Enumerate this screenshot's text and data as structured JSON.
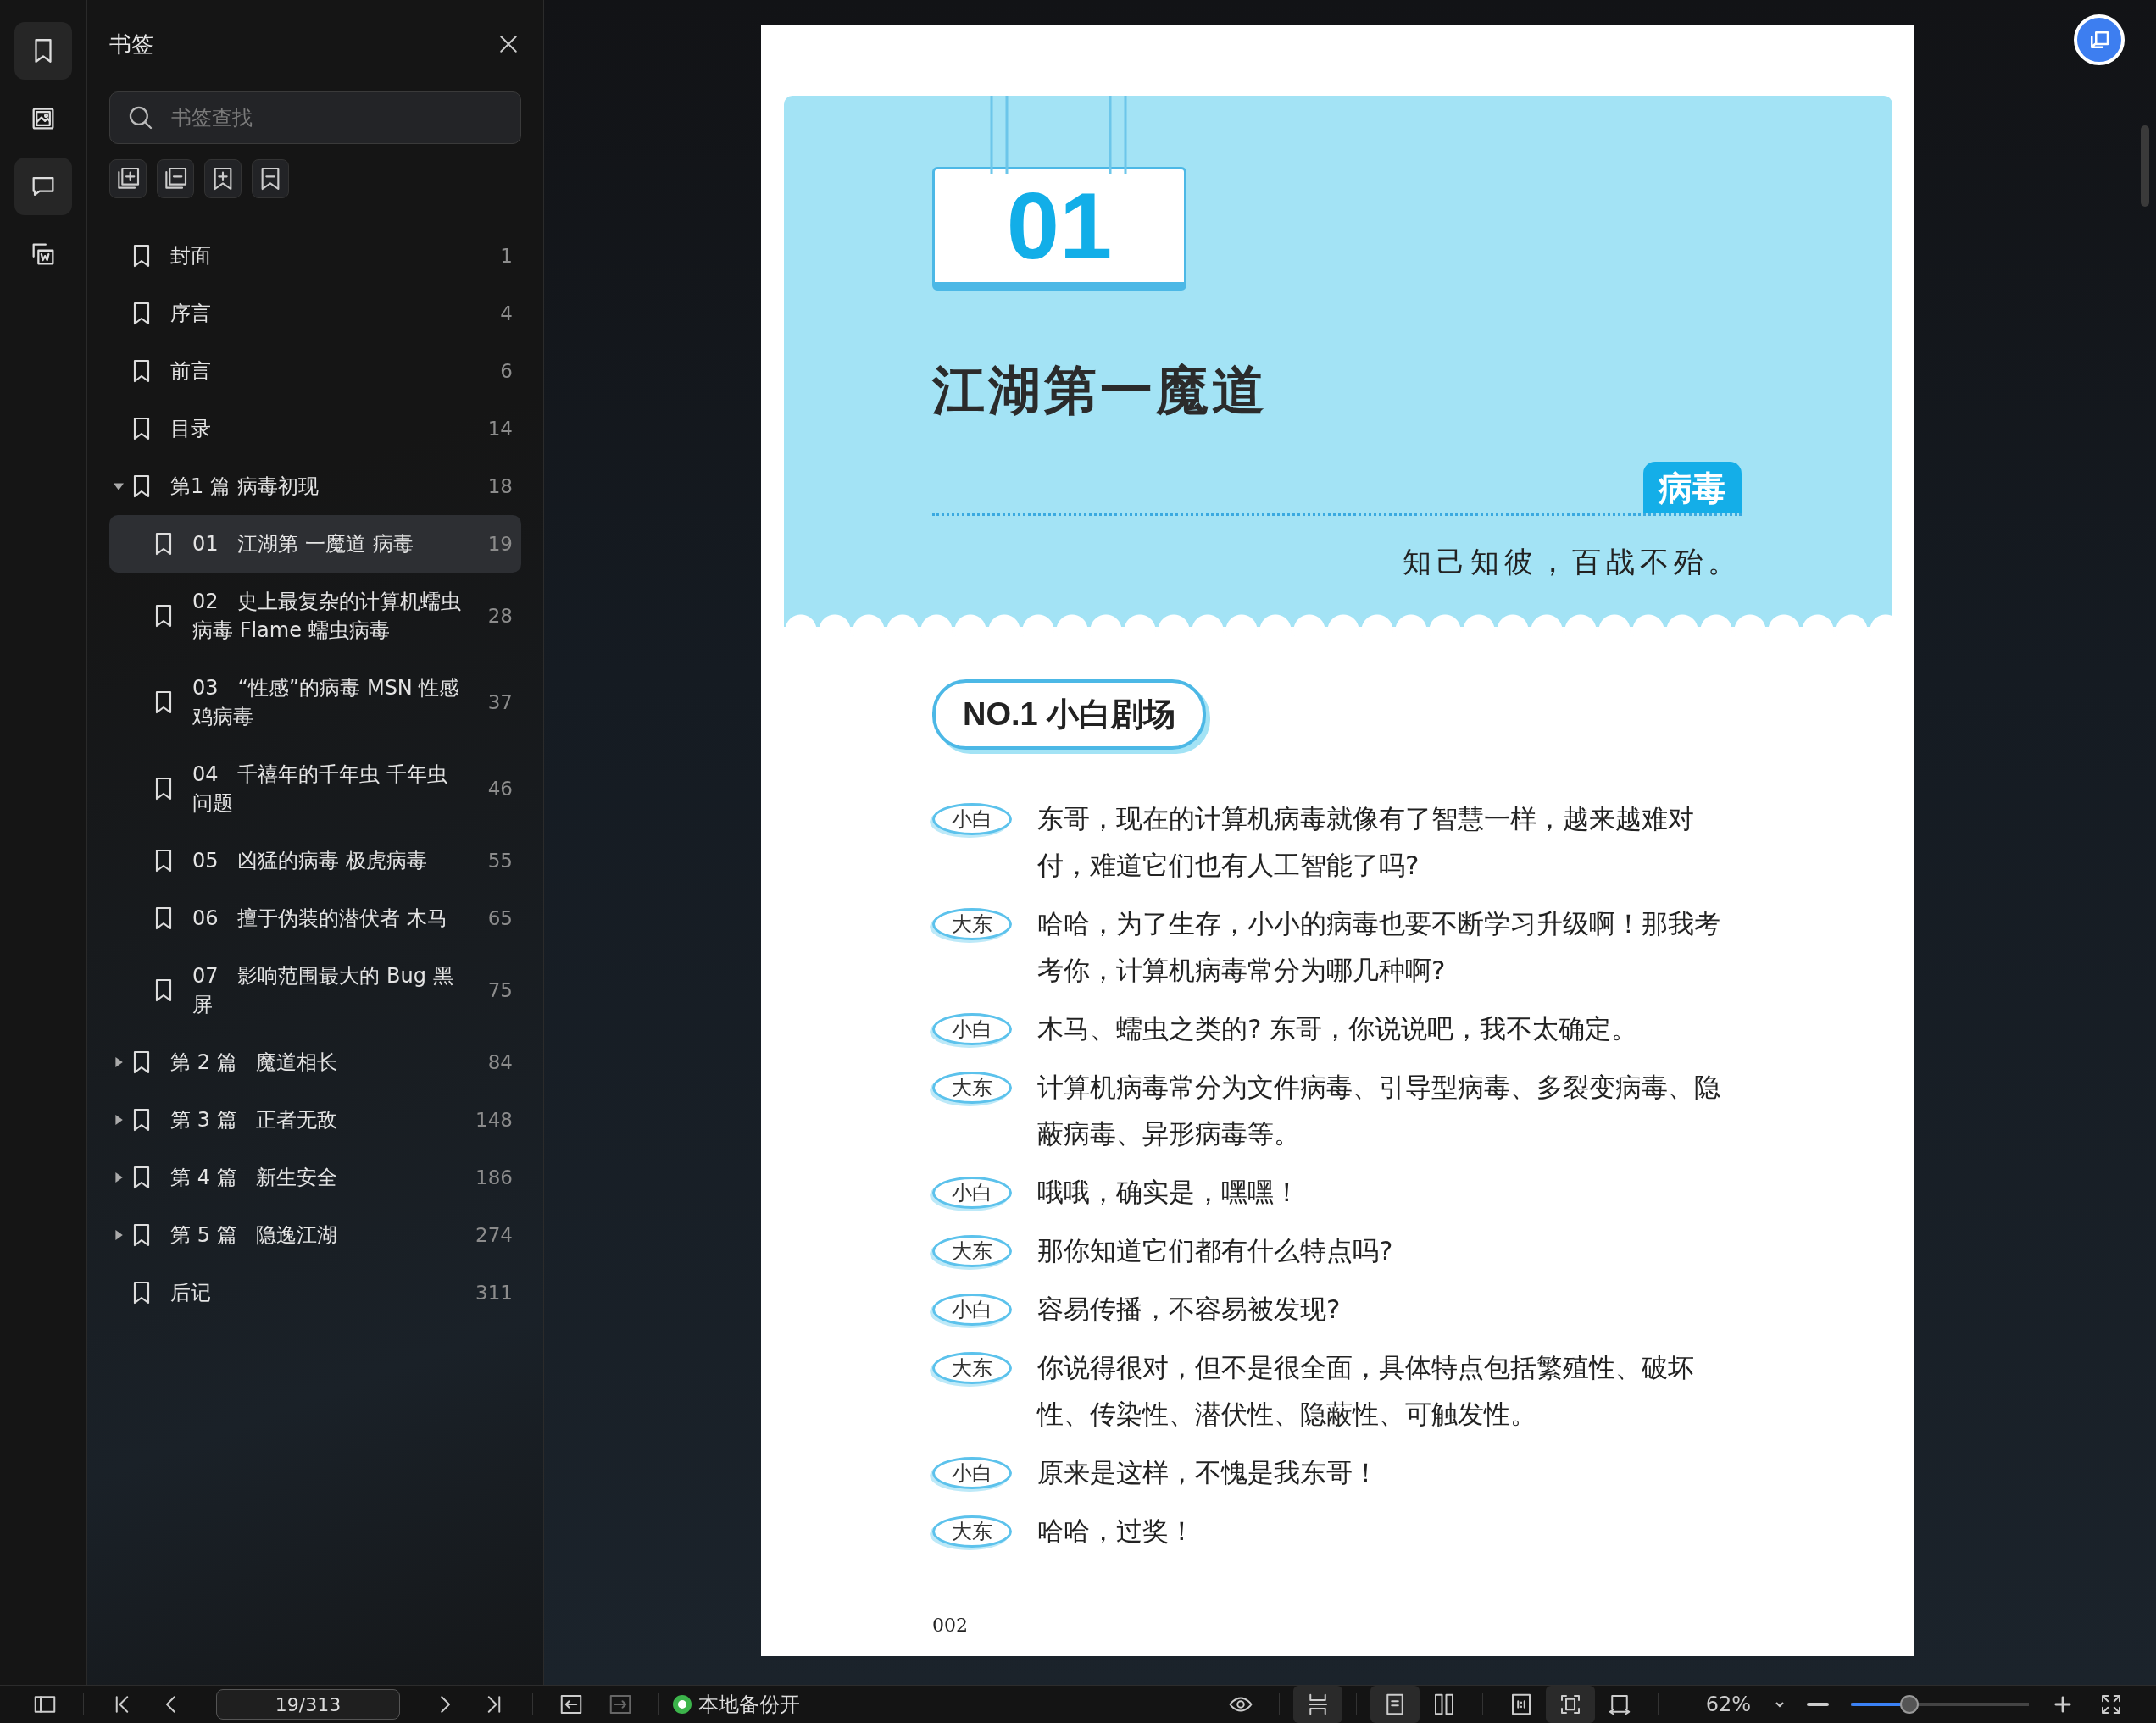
{
  "rail": [
    {
      "kind": "bookmark",
      "selected": true
    },
    {
      "kind": "image",
      "selected": false
    },
    {
      "kind": "comment",
      "selected": true
    },
    {
      "kind": "convert",
      "selected": false
    }
  ],
  "sidebar": {
    "title": "书签",
    "search": {
      "placeholder": "书签查找"
    },
    "tools": [
      {
        "kind": "add-child"
      },
      {
        "kind": "remove-child"
      },
      {
        "kind": "add"
      },
      {
        "kind": "remove"
      }
    ],
    "bookmarks": [
      {
        "label": "封面",
        "page": "1",
        "selected": false
      },
      {
        "label": "序言",
        "page": "4",
        "selected": false
      },
      {
        "label": "前言",
        "page": "6",
        "selected": false
      },
      {
        "label": "目录",
        "page": "14",
        "selected": false
      },
      {
        "label": "第1 篇 病毒初现",
        "page": "18",
        "selected": false,
        "expanded": true,
        "children": [
          {
            "label": "01   江湖第 一魔道 病毒",
            "page": "19",
            "selected": true
          },
          {
            "label": "02   史上最复杂的计算机蠕虫病毒 Flame 蠕虫病毒",
            "page": "28",
            "selected": false
          },
          {
            "label": "03   “性感”的病毒 MSN 性感鸡病毒",
            "page": "37",
            "selected": false
          },
          {
            "label": "04   千禧年的千年虫 千年虫问题",
            "page": "46",
            "selected": false
          },
          {
            "label": "05   凶猛的病毒 极虎病毒",
            "page": "55",
            "selected": false
          },
          {
            "label": "06   擅于伪装的潜伏者 木马",
            "page": "65",
            "selected": false
          },
          {
            "label": "07   影响范围最大的 Bug 黑屏",
            "page": "75",
            "selected": false
          }
        ]
      },
      {
        "label": "第 2 篇   魔道相长",
        "page": "84",
        "selected": false,
        "expanded": false
      },
      {
        "label": "第 3 篇   正者无敌",
        "page": "148",
        "selected": false,
        "expanded": false
      },
      {
        "label": "第 4 篇   新生安全",
        "page": "186",
        "selected": false,
        "expanded": false
      },
      {
        "label": "第 5 篇   隐逸江湖",
        "page": "274",
        "selected": false,
        "expanded": false
      },
      {
        "label": "后记",
        "page": "311",
        "selected": false
      }
    ]
  },
  "page": {
    "chapter_number": "01",
    "title": "江湖第一魔道",
    "tag": "病毒",
    "motto": "知己知彼，百战不殆。",
    "section_title": "NO.1 小白剧场",
    "dialogue": [
      {
        "speaker": "小白",
        "text": "东哥，现在的计算机病毒就像有了智慧一样，越来越难对付，难道它们也有人工智能了吗?"
      },
      {
        "speaker": "大东",
        "text": "哈哈，为了生存，小小的病毒也要不断学习升级啊！那我考考你，计算机病毒常分为哪几种啊?"
      },
      {
        "speaker": "小白",
        "text": "木马、蠕虫之类的? 东哥，你说说吧，我不太确定。"
      },
      {
        "speaker": "大东",
        "text": "计算机病毒常分为文件病毒、引导型病毒、多裂变病毒、隐蔽病毒、异形病毒等。"
      },
      {
        "speaker": "小白",
        "text": "哦哦，确实是，嘿嘿！"
      },
      {
        "speaker": "大东",
        "text": "那你知道它们都有什么特点吗?"
      },
      {
        "speaker": "小白",
        "text": "容易传播，不容易被发现?"
      },
      {
        "speaker": "大东",
        "text": "你说得很对，但不是很全面，具体特点包括繁殖性、破坏性、传染性、潜伏性、隐蔽性、可触发性。"
      },
      {
        "speaker": "小白",
        "text": "原来是这样，不愧是我东哥！"
      },
      {
        "speaker": "大东",
        "text": "哈哈，过奖！"
      }
    ],
    "page_number": "002"
  },
  "toolbar": {
    "left_buttons": [
      {
        "kind": "sidebar",
        "disabled": false
      },
      {
        "kind": "first",
        "disabled": false
      },
      {
        "kind": "prev",
        "disabled": false
      }
    ],
    "page_field": {
      "value": "19/313"
    },
    "right_nav": [
      {
        "kind": "next",
        "disabled": false
      },
      {
        "kind": "last",
        "disabled": false
      }
    ],
    "history": [
      {
        "kind": "back",
        "disabled": false
      },
      {
        "kind": "forward",
        "disabled": true
      }
    ],
    "backup": {
      "label": "本地备份开",
      "on": true
    },
    "view_groups": [
      [
        {
          "kind": "continuous",
          "selected": true
        }
      ],
      [
        {
          "kind": "single",
          "selected": true
        },
        {
          "kind": "double",
          "selected": false
        }
      ],
      [
        {
          "kind": "actual",
          "selected": false
        },
        {
          "kind": "fit-page",
          "selected": true
        },
        {
          "kind": "fit-width",
          "selected": false
        }
      ]
    ],
    "zoom": {
      "value": "62%",
      "level": 0.33
    }
  }
}
